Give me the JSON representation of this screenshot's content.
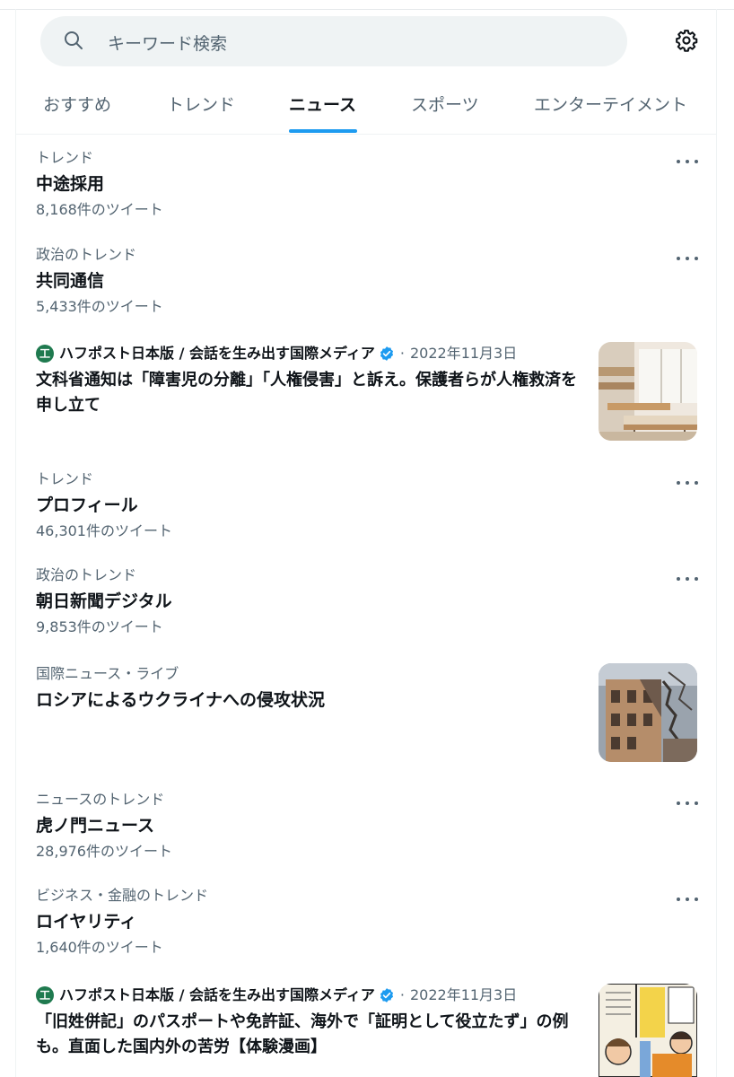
{
  "search": {
    "placeholder": "キーワード検索"
  },
  "tabs": [
    {
      "label": "おすすめ"
    },
    {
      "label": "トレンド"
    },
    {
      "label": "ニュース"
    },
    {
      "label": "スポーツ"
    },
    {
      "label": "エンターテイメント"
    }
  ],
  "active_tab": "ニュース",
  "feed": {
    "trend1": {
      "context": "トレンド",
      "title": "中途採用",
      "count": "8,168件のツイート"
    },
    "trend2": {
      "context": "政治のトレンド",
      "title": "共同通信",
      "count": "5,433件のツイート"
    },
    "news1": {
      "avatar": "工",
      "source": "ハフポスト日本版 / 会話を生み出す国際メディア",
      "separator": "·",
      "date": "2022年11月3日",
      "headline": "文科省通知は「障害児の分離」「人権侵害」と訴え。保護者らが人権救済を申し立て"
    },
    "trend3": {
      "context": "トレンド",
      "title": "プロフィール",
      "count": "46,301件のツイート"
    },
    "trend4": {
      "context": "政治のトレンド",
      "title": "朝日新聞デジタル",
      "count": "9,853件のツイート"
    },
    "live1": {
      "context": "国際ニュース・ライブ",
      "title": "ロシアによるウクライナへの侵攻状況"
    },
    "trend5": {
      "context": "ニュースのトレンド",
      "title": "虎ノ門ニュース",
      "count": "28,976件のツイート"
    },
    "trend6": {
      "context": "ビジネス・金融のトレンド",
      "title": "ロイヤリティ",
      "count": "1,640件のツイート"
    },
    "news2": {
      "avatar": "工",
      "source": "ハフポスト日本版 / 会話を生み出す国際メディア",
      "separator": "·",
      "date": "2022年11月3日",
      "headline": "「旧姓併記」のパスポートや免許証、海外で「証明として役立たず」の例も。直面した国内外の苦労【体験漫画】"
    }
  },
  "colors": {
    "accent": "#1d9bf0",
    "text": "#0f1419",
    "secondary": "#536471",
    "search_bg": "#eff3f4",
    "verified": "#1d9bf0",
    "source_avatar": "#1f7a4f"
  },
  "icons": {
    "search": "search-icon",
    "settings": "gear-icon",
    "more": "more-icon",
    "verified": "verified-badge-icon"
  }
}
